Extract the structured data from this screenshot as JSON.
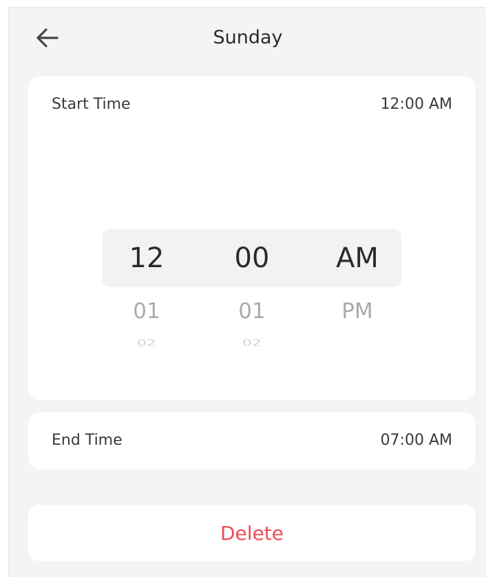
{
  "header": {
    "title": "Sunday",
    "back_icon": "arrow-left-icon"
  },
  "start_time": {
    "label": "Start Time",
    "value": "12:00 AM",
    "picker": {
      "hour": {
        "selected": "12",
        "next": "01",
        "next2": "02"
      },
      "minute": {
        "selected": "00",
        "next": "01",
        "next2": "02"
      },
      "ampm": {
        "selected": "AM",
        "next": "PM"
      }
    }
  },
  "end_time": {
    "label": "End Time",
    "value": "07:00 AM"
  },
  "actions": {
    "delete_label": "Delete"
  },
  "colors": {
    "background": "#f3f4f6",
    "card": "#ffffff",
    "delete": "#ee4b55",
    "muted": "#a9abb0"
  }
}
